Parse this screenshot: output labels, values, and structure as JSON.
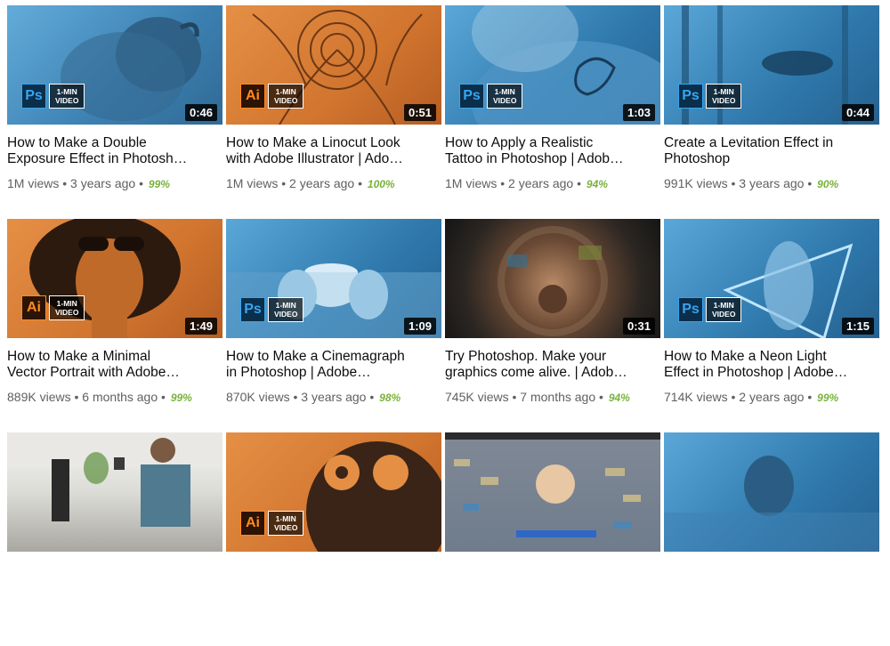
{
  "badge_text": {
    "line1": "1-MIN",
    "line2": "VIDEO"
  },
  "colors": {
    "ps_blue": "#36a6f2",
    "ai_orange": "#ff8a1f",
    "rating_green": "#79b23b"
  },
  "videos": [
    {
      "app": "Ps",
      "app_icon": "photoshop-logo",
      "duration": "0:46",
      "title_l1": "How to Make a Double",
      "title_l2": "Exposure Effect in Photosh…",
      "views": "1M views",
      "age": "3 years ago",
      "rating": "99%"
    },
    {
      "app": "Ai",
      "app_icon": "illustrator-logo",
      "duration": "0:51",
      "title_l1": "How to Make a Linocut Look",
      "title_l2": "with Adobe Illustrator | Ado…",
      "views": "1M views",
      "age": "2 years ago",
      "rating": "100%"
    },
    {
      "app": "Ps",
      "app_icon": "photoshop-logo",
      "duration": "1:03",
      "title_l1": "How to Apply a Realistic",
      "title_l2": "Tattoo in Photoshop | Adob…",
      "views": "1M views",
      "age": "2 years ago",
      "rating": "94%"
    },
    {
      "app": "Ps",
      "app_icon": "photoshop-logo",
      "duration": "0:44",
      "title_l1": "Create a Levitation Effect in",
      "title_l2": "Photoshop",
      "views": "991K views",
      "age": "3 years ago",
      "rating": "90%"
    },
    {
      "app": "Ai",
      "app_icon": "illustrator-logo",
      "duration": "1:49",
      "title_l1": "How to Make a Minimal",
      "title_l2": "Vector Portrait with Adobe…",
      "views": "889K views",
      "age": "6 months ago",
      "rating": "99%"
    },
    {
      "app": "Ps",
      "app_icon": "photoshop-logo",
      "duration": "1:09",
      "title_l1": "How to Make a Cinemagraph",
      "title_l2": "in Photoshop | Adobe…",
      "views": "870K views",
      "age": "3 years ago",
      "rating": "98%"
    },
    {
      "app": "",
      "app_icon": "",
      "duration": "0:31",
      "title_l1": "Try Photoshop. Make your",
      "title_l2": "graphics come alive. | Adob…",
      "views": "745K views",
      "age": "7 months ago",
      "rating": "94%"
    },
    {
      "app": "Ps",
      "app_icon": "photoshop-logo",
      "duration": "1:15",
      "title_l1": "How to Make a Neon Light",
      "title_l2": "Effect in Photoshop | Adobe…",
      "views": "714K views",
      "age": "2 years ago",
      "rating": "99%"
    },
    {
      "app": "",
      "app_icon": "",
      "duration": "",
      "title_l1": "",
      "title_l2": "",
      "views": "",
      "age": "",
      "rating": ""
    },
    {
      "app": "Ai",
      "app_icon": "illustrator-logo",
      "duration": "",
      "title_l1": "",
      "title_l2": "",
      "views": "",
      "age": "",
      "rating": ""
    },
    {
      "app": "",
      "app_icon": "",
      "duration": "",
      "title_l1": "",
      "title_l2": "",
      "views": "",
      "age": "",
      "rating": ""
    },
    {
      "app": "",
      "app_icon": "",
      "duration": "",
      "title_l1": "",
      "title_l2": "",
      "views": "",
      "age": "",
      "rating": ""
    }
  ]
}
